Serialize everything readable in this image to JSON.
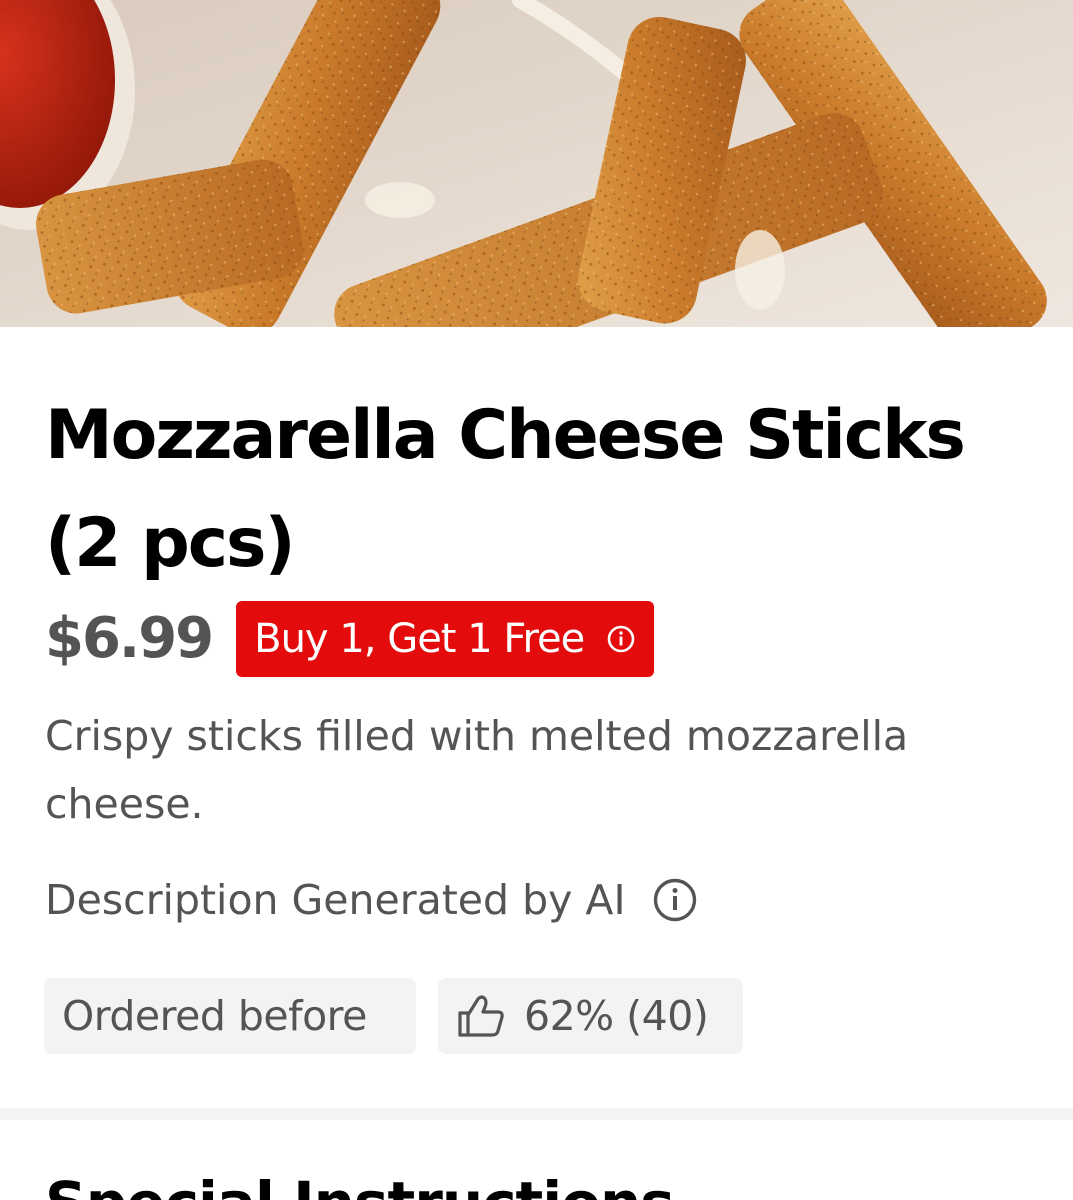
{
  "item": {
    "title": "Mozzarella Cheese Sticks (2 pcs)",
    "price": "$6.99",
    "promo": {
      "label": "Buy 1, Get 1 Free",
      "color": "#e30b0b"
    },
    "description": "Crispy sticks filled with melted mozzarella cheese.",
    "ai_note": "Description Generated by AI",
    "badges": {
      "ordered_before": "Ordered before",
      "rating": "62% (40)"
    }
  },
  "sections": {
    "special_instructions": "Special Instructions"
  },
  "icons": {
    "promo_info": "info-icon",
    "ai_info": "info-icon",
    "rating": "thumbs-up-icon"
  },
  "colors": {
    "promo_red": "#e30b0b",
    "text_secondary": "#545454",
    "chip_bg": "#f3f3f3"
  }
}
